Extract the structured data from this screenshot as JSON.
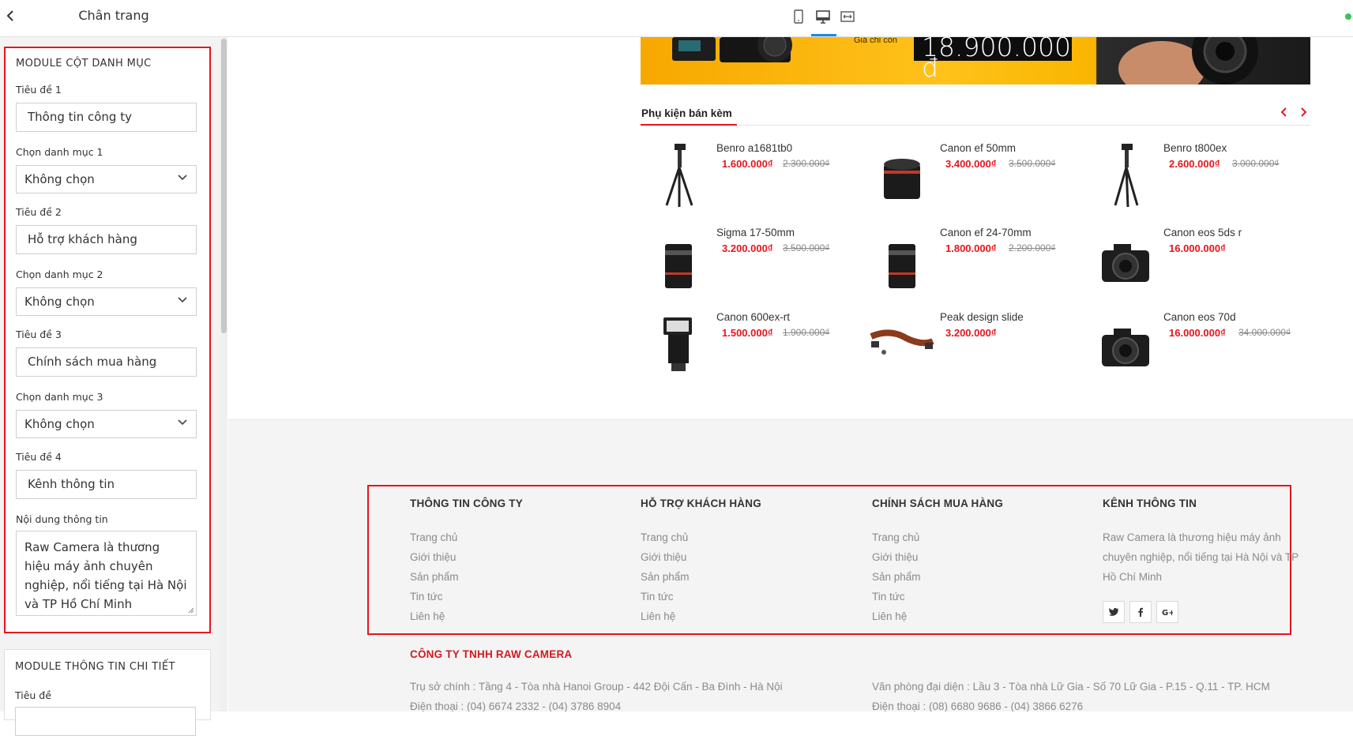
{
  "left_panel": {
    "title": "Chân trang",
    "module1": {
      "heading": "MODULE CỘT DANH MỤC",
      "fields": [
        {
          "label": "Tiêu đề 1",
          "value": "Thông tin công ty"
        },
        {
          "label": "Chọn danh mục 1",
          "value": "Không chọn"
        },
        {
          "label": "Tiêu đề 2",
          "value": "Hỗ trợ khách hàng"
        },
        {
          "label": "Chọn danh mục 2",
          "value": "Không chọn"
        },
        {
          "label": "Tiêu đề 3",
          "value": "Chính sách mua hàng"
        },
        {
          "label": "Chọn danh mục 3",
          "value": "Không chọn"
        },
        {
          "label": "Tiêu đề 4",
          "value": "Kênh thông tin"
        },
        {
          "label": "Nội dung thông tin",
          "value": "Raw Camera là thương hiệu máy ảnh chuyên nghiệp, nổi tiếng tại Hà Nội và TP Hồ Chí Minh"
        }
      ]
    },
    "module2": {
      "heading": "MODULE THÔNG TIN CHI TIẾT",
      "fields": [
        {
          "label": "Tiêu đề"
        }
      ]
    }
  },
  "toolbar": {
    "devices": [
      "mobile-icon",
      "desktop-icon",
      "fullwidth-icon"
    ],
    "active_device": "desktop"
  },
  "banner": {
    "caption": "Giá chỉ còn",
    "price": "18.900.000 đ"
  },
  "accessories": {
    "heading": "Phụ kiện bán kèm",
    "products": [
      {
        "name": "Benro a1681tb0",
        "price": "1.600.000₫",
        "old_price": "2.300.000₫",
        "icon": "tripod-icon"
      },
      {
        "name": "Canon ef 50mm",
        "price": "3.400.000₫",
        "old_price": "3.500.000₫",
        "icon": "lens-icon"
      },
      {
        "name": "Benro t800ex",
        "price": "2.600.000₫",
        "old_price": "3.000.000₫",
        "icon": "tripod-icon"
      },
      {
        "name": "Sigma 17-50mm",
        "price": "3.200.000₫",
        "old_price": "3.500.000₫",
        "icon": "zoom-lens-icon"
      },
      {
        "name": "Canon ef 24-70mm",
        "price": "1.800.000₫",
        "old_price": "2.200.000₫",
        "icon": "zoom-lens-icon"
      },
      {
        "name": "Canon eos 5ds r",
        "price": "16.000.000₫",
        "old_price": "",
        "icon": "camera-icon"
      },
      {
        "name": "Canon 600ex-rt",
        "price": "1.500.000₫",
        "old_price": "1.900.000₫",
        "icon": "flash-icon"
      },
      {
        "name": "Peak design slide",
        "price": "3.200.000₫",
        "old_price": "",
        "icon": "strap-icon"
      },
      {
        "name": "Canon eos 70d",
        "price": "16.000.000₫",
        "old_price": "34.000.000₫",
        "icon": "camera-icon"
      }
    ]
  },
  "footer": {
    "columns": [
      {
        "title": "THÔNG TIN CÔNG TY",
        "links": [
          "Trang chủ",
          "Giới thiệu",
          "Sản phẩm",
          "Tin tức",
          "Liên hệ"
        ]
      },
      {
        "title": "HỖ TRỢ KHÁCH HÀNG",
        "links": [
          "Trang chủ",
          "Giới thiệu",
          "Sản phẩm",
          "Tin tức",
          "Liên hệ"
        ]
      },
      {
        "title": "CHÍNH SÁCH MUA HÀNG",
        "links": [
          "Trang chủ",
          "Giới thiệu",
          "Sản phẩm",
          "Tin tức",
          "Liên hệ"
        ]
      },
      {
        "title": "KÊNH THÔNG TIN",
        "about": "Raw Camera là thương hiệu máy ảnh chuyên nghiệp, nổi tiếng tại Hà Nội và TP Hồ Chí Minh"
      }
    ],
    "social": [
      "twitter-icon",
      "facebook-icon",
      "google-plus-icon"
    ],
    "company": {
      "name": "CÔNG TY TNHH RAW CAMERA",
      "hq": "Trụ sở chính : Tầng 4 - Tòa nhà Hanoi Group - 442 Đội Cấn - Ba Đình - Hà Nội",
      "hq_phone": "Điện thoại : (04) 6674 2332 - (04) 3786 8904",
      "office": "Văn phòng đại diện : Lầu 3 - Tòa nhà Lữ Gia - Số 70 Lữ Gia - P.15 - Q.11 - TP. HCM",
      "office_phone": "Điện thoại : (08) 6680 9686 - (04) 3866 6276"
    }
  },
  "colors": {
    "accent_red": "#e8141c",
    "active_blue": "#1e88e5",
    "status_green": "#3ac15a"
  }
}
